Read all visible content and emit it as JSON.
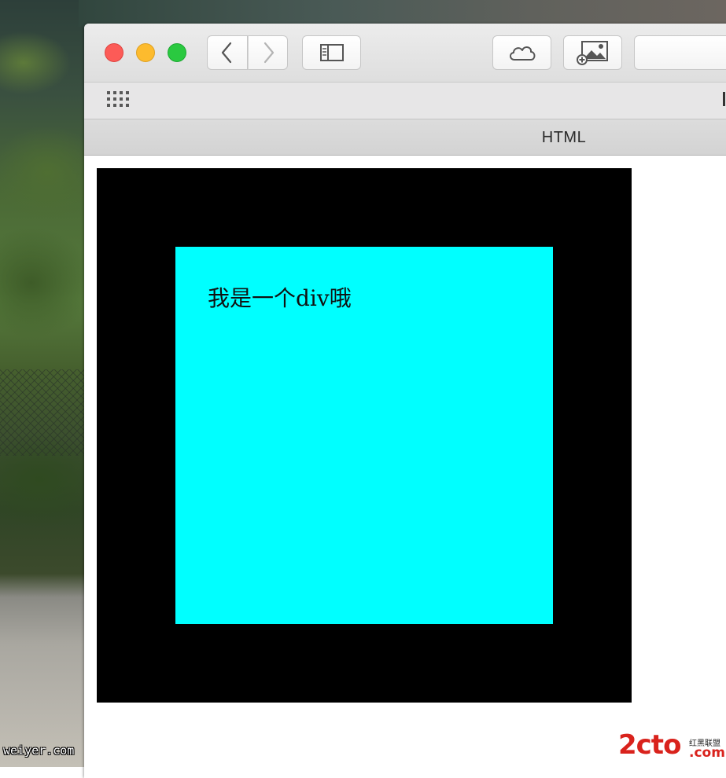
{
  "tab": {
    "title": "HTML"
  },
  "page": {
    "inner_text": "我是一个div哦"
  },
  "colors": {
    "outer_div": "#000000",
    "inner_div": "#00ffff",
    "close": "#fc5b57",
    "minimize": "#fdbb2e",
    "maximize": "#2ac940"
  },
  "watermarks": {
    "left": "weiyer.com",
    "right_main": "2cto",
    "right_sub": "红黑联盟",
    "right_com": ".com"
  },
  "icons": {
    "back": "chevron-left-icon",
    "forward": "chevron-right-icon",
    "sidebar": "sidebar-icon",
    "cloud": "icloud-tabs-icon",
    "image": "add-image-icon",
    "favorites": "favorites-grid-icon"
  }
}
